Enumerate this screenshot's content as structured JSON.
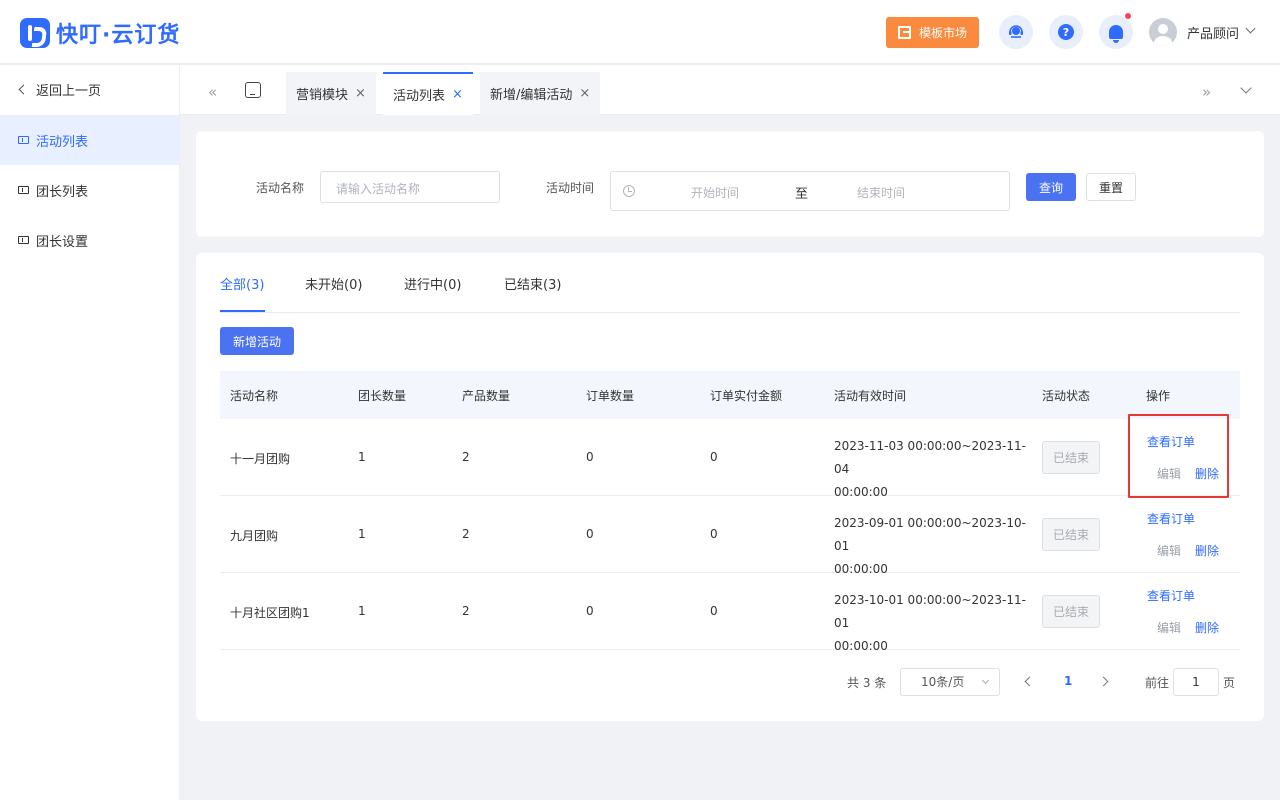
{
  "app": {
    "title": "快叮·云订货"
  },
  "header": {
    "template_market": "模板市场",
    "help_glyph": "?",
    "user_name": "产品顾问",
    "icons": [
      "service-icon",
      "help-icon",
      "bell-icon"
    ]
  },
  "sidebar": {
    "back_label": "返回上一页",
    "items": [
      {
        "label": "活动列表",
        "active": true
      },
      {
        "label": "团长列表",
        "active": false
      },
      {
        "label": "团长设置",
        "active": false
      }
    ]
  },
  "tabbar": {
    "left_glyph": "«",
    "right_glyph": "»",
    "tabs": [
      {
        "label": "营销模块",
        "active": false
      },
      {
        "label": "活动列表",
        "active": true
      },
      {
        "label": "新增/编辑活动",
        "active": false
      }
    ],
    "close_glyph": "×"
  },
  "filter": {
    "name_label": "活动名称",
    "name_placeholder": "请输入活动名称",
    "time_label": "活动时间",
    "start_placeholder": "开始时间",
    "range_sep": "至",
    "end_placeholder": "结束时间",
    "query_btn": "查询",
    "reset_btn": "重置"
  },
  "status_tabs": [
    {
      "label": "全部(3)",
      "active": true
    },
    {
      "label": "未开始(0)",
      "active": false
    },
    {
      "label": "进行中(0)",
      "active": false
    },
    {
      "label": "已结束(3)",
      "active": false
    }
  ],
  "add_button": "新增活动",
  "table": {
    "columns": [
      "活动名称",
      "团长数量",
      "产品数量",
      "订单数量",
      "订单实付金额",
      "活动有效时间",
      "活动状态",
      "操作"
    ],
    "rows": [
      {
        "name": "十一月团购",
        "leaders": "1",
        "products": "2",
        "orders": "0",
        "amount": "0",
        "time_start": "2023-11-03 00:00:00~2023-11-04",
        "time_end": "00:00:00",
        "status": "已结束",
        "op_view": "查看订单",
        "op_edit": "编辑",
        "op_delete": "删除"
      },
      {
        "name": "九月团购",
        "leaders": "1",
        "products": "2",
        "orders": "0",
        "amount": "0",
        "time_start": "2023-09-01 00:00:00~2023-10-01",
        "time_end": "00:00:00",
        "status": "已结束",
        "op_view": "查看订单",
        "op_edit": "编辑",
        "op_delete": "删除"
      },
      {
        "name": "十月社区团购1",
        "leaders": "1",
        "products": "2",
        "orders": "0",
        "amount": "0",
        "time_start": "2023-10-01 00:00:00~2023-11-01",
        "time_end": "00:00:00",
        "status": "已结束",
        "op_view": "查看订单",
        "op_edit": "编辑",
        "op_delete": "删除"
      }
    ]
  },
  "pagination": {
    "total": "共 3 条",
    "page_size": "10条/页",
    "current_page": "1",
    "goto_prefix": "前往",
    "goto_value": "1",
    "goto_suffix": "页"
  },
  "colors": {
    "primary": "#2f6bff",
    "button": "#4b73f1",
    "template_button": "#f98a3e",
    "highlight_border": "#e53935"
  }
}
